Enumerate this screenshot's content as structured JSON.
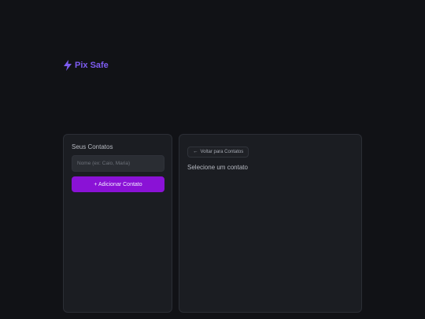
{
  "brand": {
    "title": "Pix Safe",
    "icon": "lightning-icon",
    "accent": "#7d5cf0"
  },
  "contacts_panel": {
    "title": "Seus Contatos",
    "name_input": {
      "placeholder": "Nome (ex: Caio, Maria)",
      "value": ""
    },
    "add_button_label": "+ Adicionar Contato",
    "add_button_color": "#8a12d6"
  },
  "detail_panel": {
    "back_button_label": "Voltar para Contatos",
    "back_icon": "arrow-left-icon",
    "empty_message": "Selecione um contato"
  }
}
